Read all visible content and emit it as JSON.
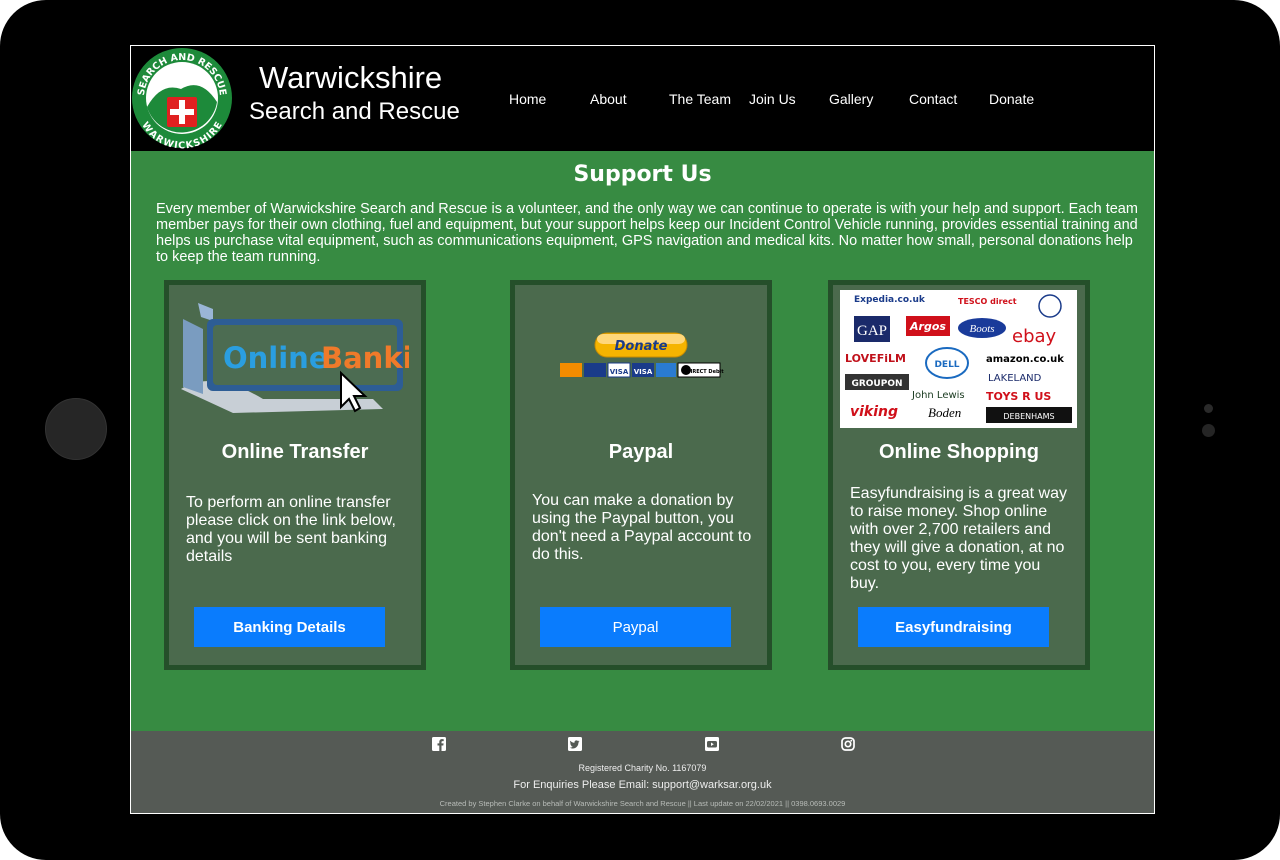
{
  "site": {
    "title_line1": "Warwickshire",
    "title_line2": "Search and Rescue",
    "logo": {
      "top_text": "SEARCH AND RESCUE",
      "bottom_text": "WARWICKSHIRE"
    }
  },
  "nav": {
    "items": [
      {
        "label": "Home"
      },
      {
        "label": "About"
      },
      {
        "label": "The Team"
      },
      {
        "label": "Join Us"
      },
      {
        "label": "Gallery"
      },
      {
        "label": "Contact"
      },
      {
        "label": "Donate"
      }
    ]
  },
  "main": {
    "title": "Support Us",
    "intro": "Every member of Warwickshire Search and Rescue is a volunteer, and the only way we can continue to operate is with your help and support. Each team member pays for their own clothing, fuel and equipment, but your support helps keep our Incident Control Vehicle running, provides essential training and helps us purchase vital equipment, such as communications equipment, GPS navigation and medical kits. No matter how small, personal donations help to keep the team running."
  },
  "cards": [
    {
      "title": "Online Transfer",
      "text": "To perform an online transfer please click on the link below, and you will be sent banking details",
      "button": "Banking Details",
      "image_text": [
        "Online",
        "Banking"
      ]
    },
    {
      "title": "Paypal",
      "text": "You can make a donation by using the Paypal button, you don't need a Paypal account to do this.",
      "button": "Paypal",
      "image_text": [
        "Donate",
        "VISA",
        "VISA",
        "DIRECT Debit"
      ]
    },
    {
      "title": "Online Shopping",
      "text": "Easyfundraising is a great way to raise money. Shop online with over 2,700 retailers and they will give a donation, at no cost to you, every time you buy.",
      "button": "Easyfundraising",
      "retailers": [
        "Expedia.co.uk",
        "TESCO direct",
        "GAP",
        "Argos",
        "Boots",
        "ebay",
        "LOVEFiLM",
        "DELL",
        "amazon.co.uk",
        "LAKELAND",
        "GROUPON",
        "John Lewis",
        "TOYS R US",
        "viking",
        "Boden",
        "DEBENHAMS"
      ]
    }
  ],
  "footer": {
    "social": [
      "facebook-icon",
      "twitter-icon",
      "youtube-icon",
      "instagram-icon"
    ],
    "charity": "Registered Charity No. 1167079",
    "email": "For Enquiries Please Email: support@warksar.org.uk",
    "credit": "Created by Stephen Clarke on behalf of Warwickshire Search and Rescue || Last update on 22/02/2021 || 0398.0693.0029"
  },
  "colors": {
    "header": "#000000",
    "main_bg": "#378b42",
    "card_bg": "#4b6a4d",
    "card_border": "#254f2a",
    "button": "#0a7cfd",
    "footer": "#555a55"
  }
}
